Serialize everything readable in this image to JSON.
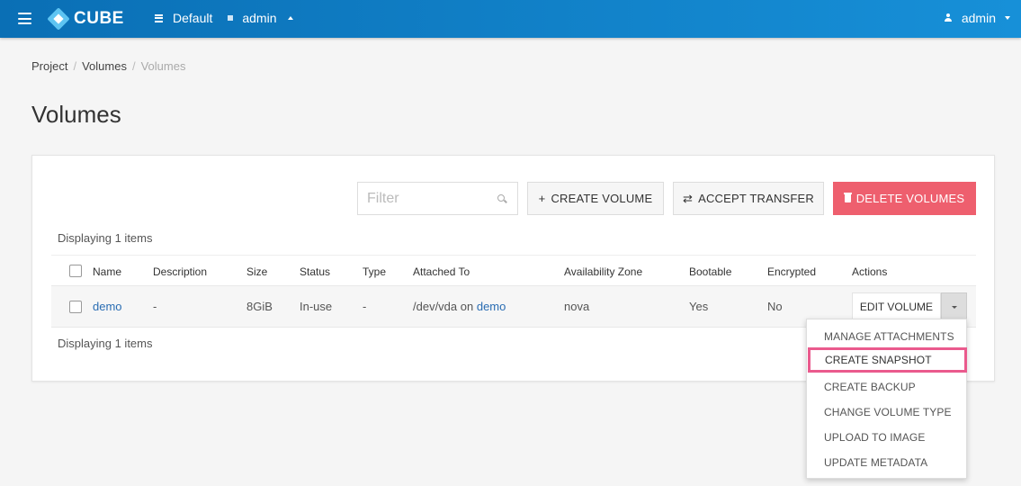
{
  "header": {
    "logo_text": "CUBE",
    "domain": "Default",
    "project": "admin",
    "user": "admin"
  },
  "breadcrumb": [
    "Project",
    "Volumes",
    "Volumes"
  ],
  "page_title": "Volumes",
  "toolbar": {
    "filter_placeholder": "Filter",
    "create_label": "CREATE VOLUME",
    "accept_label": "ACCEPT TRANSFER",
    "delete_label": "DELETE VOLUMES"
  },
  "display_count": "Displaying 1 items",
  "table": {
    "columns": [
      "Name",
      "Description",
      "Size",
      "Status",
      "Type",
      "Attached To",
      "Availability Zone",
      "Bootable",
      "Encrypted",
      "Actions"
    ],
    "rows": [
      {
        "name": "demo",
        "description": "-",
        "size": "8GiB",
        "status": "In-use",
        "type": "-",
        "attached_prefix": "/dev/vda on",
        "attached_link": "demo",
        "zone": "nova",
        "bootable": "Yes",
        "encrypted": "No",
        "action": "EDIT VOLUME"
      }
    ]
  },
  "actions_menu": [
    "MANAGE ATTACHMENTS",
    "CREATE SNAPSHOT",
    "CREATE BACKUP",
    "CHANGE VOLUME TYPE",
    "UPLOAD TO IMAGE",
    "UPDATE METADATA"
  ],
  "colors": {
    "header": "#1485cf",
    "danger": "#ee5f6e",
    "highlight": "#ea5a8d",
    "link": "#2a6db3"
  }
}
